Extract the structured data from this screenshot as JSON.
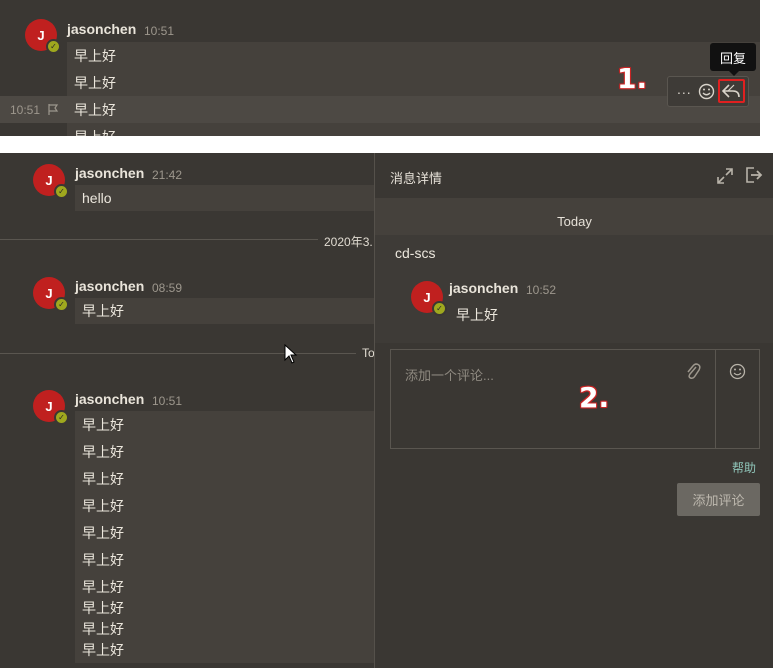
{
  "top": {
    "user": "jasonchen",
    "time": "10:51",
    "messages": [
      "早上好",
      "早上好",
      "早上好",
      "早上好"
    ],
    "hover_time": "10:51",
    "tooltip": "回复",
    "toolbar_more": "...",
    "callout": "1."
  },
  "chat": {
    "groups": [
      {
        "user": "jasonchen",
        "time": "21:42",
        "messages": [
          "hello"
        ]
      },
      {
        "user": "jasonchen",
        "time": "08:59",
        "messages": [
          "早上好"
        ]
      },
      {
        "user": "jasonchen",
        "time": "10:51",
        "messages": [
          "早上好",
          "早上好",
          "早上好",
          "早上好",
          "早上好",
          "早上好",
          "早上好",
          "早上好",
          "早上好",
          "早上好"
        ]
      }
    ],
    "date_divider": "2020年3.",
    "today_divider": "To"
  },
  "avatar_letter": "J",
  "detail": {
    "title": "消息详情",
    "today": "Today",
    "channel": "cd-scs",
    "user": "jasonchen",
    "time": "10:52",
    "message": "早上好",
    "placeholder": "添加一个评论...",
    "callout": "2.",
    "help": "帮助",
    "add_button": "添加评论"
  },
  "colors": {
    "background": "#3a3733",
    "message_bg": "#45413c",
    "avatar": "#c0201f",
    "status_ok": "#9fa81e",
    "highlight": "#e02020",
    "link": "#8fc4b8"
  },
  "icons": [
    "flag-icon",
    "emoji-icon",
    "reply-icon",
    "expand-icon",
    "exit-icon",
    "paperclip-icon",
    "smiley-icon"
  ]
}
